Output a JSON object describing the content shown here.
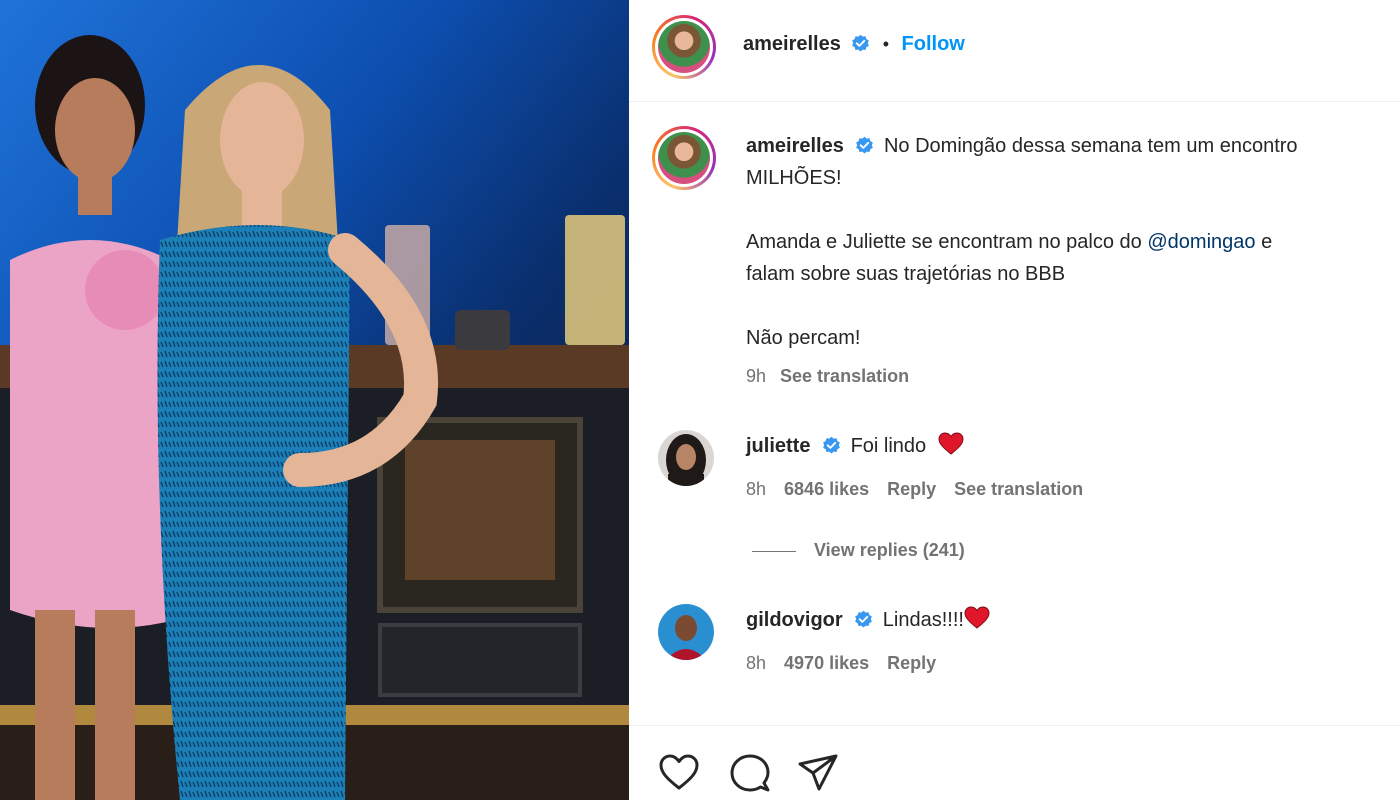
{
  "post": {
    "author": "ameirelles",
    "follow_label": "Follow",
    "separator": "•",
    "caption_line1": "No Domingão dessa semana tem um encontro",
    "caption_line2": "MILHÕES!",
    "caption_para2_start": "Amanda e Juliette se encontram no palco do ",
    "caption_mention": "@domingao",
    "caption_para2_end": " e",
    "caption_para2_line2": "falam sobre suas trajetórias no BBB",
    "caption_para3": "Não percam!",
    "time": "9h",
    "see_translation": "See translation"
  },
  "comments": [
    {
      "user": "juliette",
      "text": "Foi lindo",
      "emoji": "heart",
      "time": "8h",
      "likes": "6846 likes",
      "reply": "Reply",
      "see_translation": "See translation",
      "view_replies": "View replies (241)"
    },
    {
      "user": "gildovigor",
      "text": "Lindas!!!!",
      "emoji": "heart",
      "time": "8h",
      "likes": "4970 likes",
      "reply": "Reply"
    }
  ],
  "icons": {
    "like": "heart-outline-icon",
    "comment": "speech-bubble-icon",
    "share": "paper-plane-icon",
    "verified": "verified-badge-icon"
  },
  "colors": {
    "accent": "#0095f6",
    "verified": "#3897f0",
    "heart": "#e0162b",
    "mention": "#00376b",
    "muted": "#737373"
  }
}
